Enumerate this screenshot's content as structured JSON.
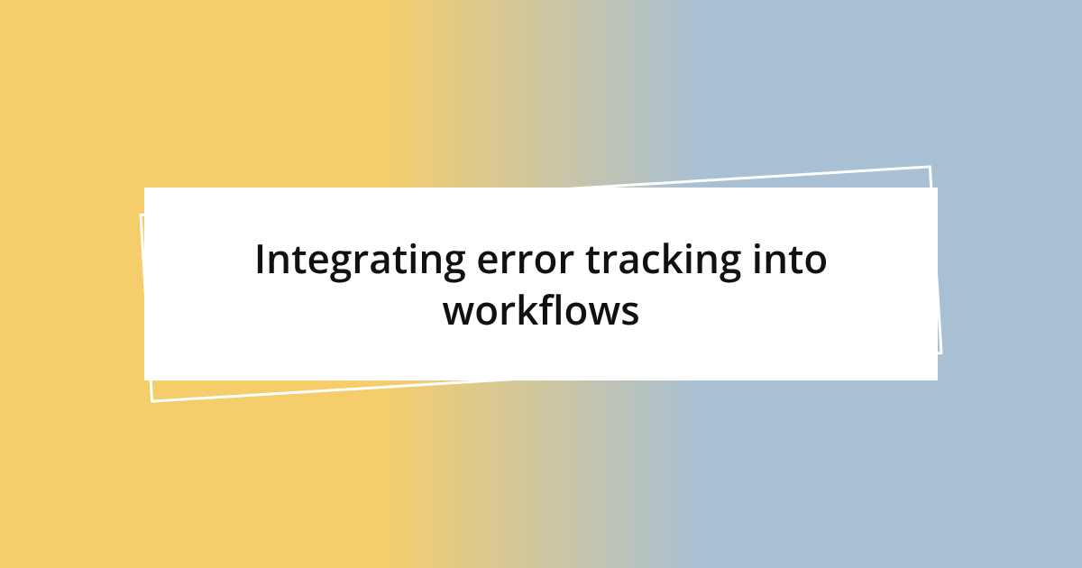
{
  "title": "Integrating error tracking into workflows"
}
